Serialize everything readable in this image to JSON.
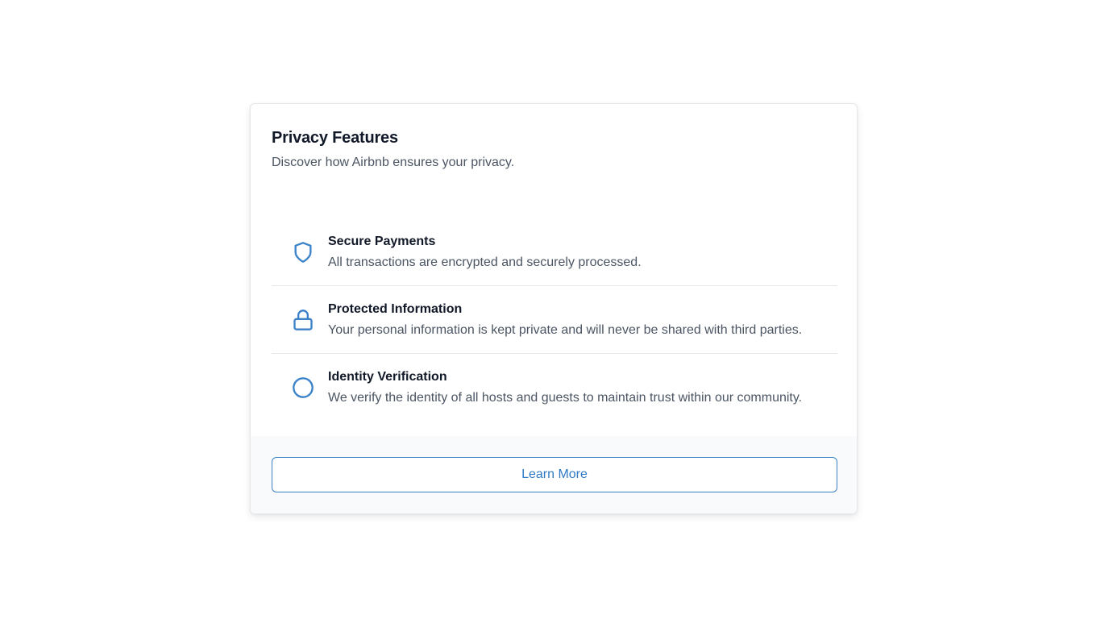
{
  "card": {
    "title": "Privacy Features",
    "subtitle": "Discover how Airbnb ensures your privacy."
  },
  "features": [
    {
      "icon": "shield-icon",
      "title": "Secure Payments",
      "description": "All transactions are encrypted and securely processed."
    },
    {
      "icon": "lock-icon",
      "title": "Protected Information",
      "description": "Your personal information is kept private and will never be shared with third parties."
    },
    {
      "icon": "circle-icon",
      "title": "Identity Verification",
      "description": "We verify the identity of all hosts and guests to maintain trust within our community."
    }
  ],
  "footer": {
    "button_label": "Learn More"
  },
  "colors": {
    "accent": "#3b82c8",
    "title_text": "#111827",
    "body_text": "#4b5563",
    "footer_background": "#f8fafc",
    "divider": "#e5e7eb"
  }
}
